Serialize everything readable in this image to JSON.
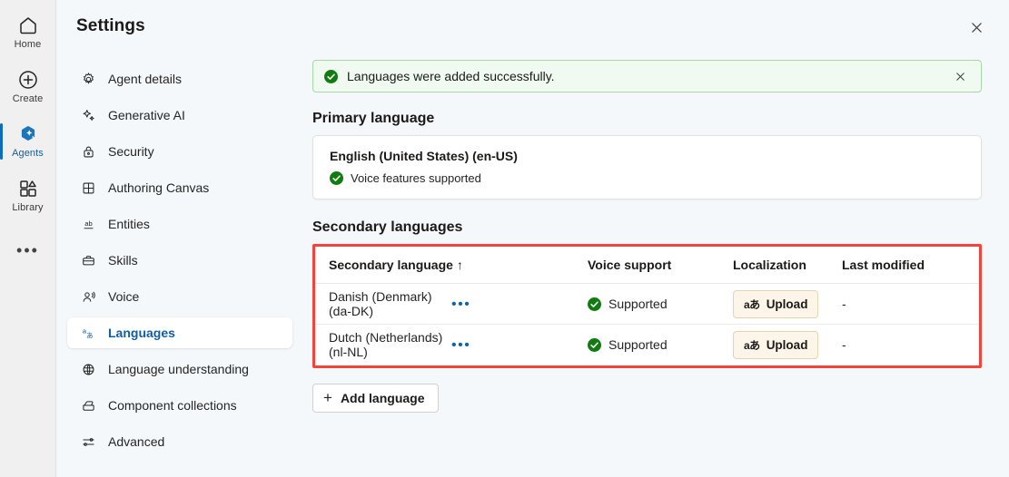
{
  "rail": {
    "items": [
      {
        "label": "Home",
        "icon": "home-icon",
        "selected": false
      },
      {
        "label": "Create",
        "icon": "plus-circle-icon",
        "selected": false
      },
      {
        "label": "Agents",
        "icon": "agents-hexagon-icon",
        "selected": true
      },
      {
        "label": "Library",
        "icon": "library-icon",
        "selected": false
      }
    ],
    "more_label": "•••"
  },
  "header": {
    "title": "Settings",
    "close_label": "Close"
  },
  "nav": {
    "items": [
      {
        "label": "Agent details",
        "icon": "gear-icon"
      },
      {
        "label": "Generative AI",
        "icon": "sparkle-icon"
      },
      {
        "label": "Security",
        "icon": "lock-icon"
      },
      {
        "label": "Authoring Canvas",
        "icon": "grid-icon"
      },
      {
        "label": "Entities",
        "icon": "ab-underline-icon"
      },
      {
        "label": "Skills",
        "icon": "briefcase-icon"
      },
      {
        "label": "Voice",
        "icon": "voice-person-icon"
      },
      {
        "label": "Languages",
        "icon": "translate-icon"
      },
      {
        "label": "Language understanding",
        "icon": "globe-brain-icon"
      },
      {
        "label": "Component collections",
        "icon": "collection-icon"
      },
      {
        "label": "Advanced",
        "icon": "sliders-icon"
      }
    ],
    "selected_index": 7
  },
  "banner": {
    "message": "Languages were added successfully.",
    "icon": "success-check-icon",
    "close_icon": "close-icon",
    "background": "#f1faf1",
    "border": "#a7d8a9",
    "accent": "#107c10"
  },
  "primary": {
    "section_title": "Primary language",
    "language": "English (United States) (en-US)",
    "voice_status": "Voice features supported",
    "voice_icon": "success-check-icon"
  },
  "secondary": {
    "section_title": "Secondary languages",
    "highlight_color": "#f4433a",
    "columns": [
      {
        "label": "Secondary language",
        "sort": "↑"
      },
      {
        "label": ""
      },
      {
        "label": "Voice support"
      },
      {
        "label": "Localization"
      },
      {
        "label": "Last modified"
      }
    ],
    "rows": [
      {
        "language": "Danish (Denmark) (da-DK)",
        "menu": "•••",
        "voice_support": "Supported",
        "voice_icon": "success-check-icon",
        "localization_button": "Upload",
        "localization_icon": "aあ",
        "last_modified": "-"
      },
      {
        "language": "Dutch (Netherlands) (nl-NL)",
        "menu": "•••",
        "voice_support": "Supported",
        "voice_icon": "success-check-icon",
        "localization_button": "Upload",
        "localization_icon": "aあ",
        "last_modified": "-"
      }
    ],
    "add_button": "Add language",
    "add_icon": "plus-icon"
  }
}
